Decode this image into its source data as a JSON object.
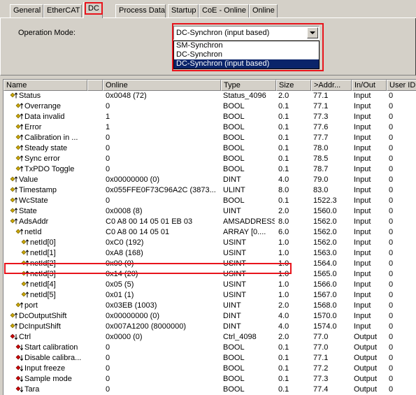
{
  "tabs": [
    {
      "label": "General"
    },
    {
      "label": "EtherCAT"
    },
    {
      "label": "DC"
    },
    {
      "label": "Process Data"
    },
    {
      "label": "Startup"
    },
    {
      "label": "CoE - Online"
    },
    {
      "label": "Online"
    }
  ],
  "dc": {
    "operation_mode_label": "Operation Mode:",
    "selected": "DC-Synchron (input based)",
    "options": [
      "SM-Synchron",
      "DC-Synchron",
      "DC-Synchron (input based)"
    ]
  },
  "columns": [
    "Name",
    "Online",
    "Type",
    "Size",
    ">Addr...",
    "In/Out",
    "User ID"
  ],
  "colors": {
    "input_icon": "#c8a400",
    "output_icon": "#cc0000",
    "highlight": "#e8141c",
    "selection": "#0a246a"
  },
  "rows": [
    {
      "name": "Status",
      "online": "0x0048 (72)",
      "type": "Status_4096",
      "size": "2.0",
      "addr": "77.1",
      "io": "Input",
      "uid": "0",
      "indent": 0,
      "dir": "in",
      "expand": "minus"
    },
    {
      "name": "Overrange",
      "online": "0",
      "type": "BOOL",
      "size": "0.1",
      "addr": "77.1",
      "io": "Input",
      "uid": "0",
      "indent": 1,
      "dir": "in"
    },
    {
      "name": "Data invalid",
      "online": "1",
      "type": "BOOL",
      "size": "0.1",
      "addr": "77.3",
      "io": "Input",
      "uid": "0",
      "indent": 1,
      "dir": "in"
    },
    {
      "name": "Error",
      "online": "1",
      "type": "BOOL",
      "size": "0.1",
      "addr": "77.6",
      "io": "Input",
      "uid": "0",
      "indent": 1,
      "dir": "in"
    },
    {
      "name": "Calibration in ...",
      "online": "0",
      "type": "BOOL",
      "size": "0.1",
      "addr": "77.7",
      "io": "Input",
      "uid": "0",
      "indent": 1,
      "dir": "in"
    },
    {
      "name": "Steady state",
      "online": "0",
      "type": "BOOL",
      "size": "0.1",
      "addr": "78.0",
      "io": "Input",
      "uid": "0",
      "indent": 1,
      "dir": "in"
    },
    {
      "name": "Sync error",
      "online": "0",
      "type": "BOOL",
      "size": "0.1",
      "addr": "78.5",
      "io": "Input",
      "uid": "0",
      "indent": 1,
      "dir": "in"
    },
    {
      "name": "TxPDO Toggle",
      "online": "0",
      "type": "BOOL",
      "size": "0.1",
      "addr": "78.7",
      "io": "Input",
      "uid": "0",
      "indent": 1,
      "dir": "in"
    },
    {
      "name": "Value",
      "online": "0x00000000 (0)",
      "type": "DINT",
      "size": "4.0",
      "addr": "79.0",
      "io": "Input",
      "uid": "0",
      "indent": 0,
      "dir": "in"
    },
    {
      "name": "Timestamp",
      "online": "0x055FFE0F73C96A2C (3873...",
      "type": "ULINT",
      "size": "8.0",
      "addr": "83.0",
      "io": "Input",
      "uid": "0",
      "indent": 0,
      "dir": "in"
    },
    {
      "name": "WcState",
      "online": "0",
      "type": "BOOL",
      "size": "0.1",
      "addr": "1522.3",
      "io": "Input",
      "uid": "0",
      "indent": 0,
      "dir": "in"
    },
    {
      "name": "State",
      "online": "0x0008 (8)",
      "type": "UINT",
      "size": "2.0",
      "addr": "1560.0",
      "io": "Input",
      "uid": "0",
      "indent": 0,
      "dir": "in"
    },
    {
      "name": "AdsAddr",
      "online": "C0 A8 00 14 05 01 EB 03",
      "type": "AMSADDRESS",
      "size": "8.0",
      "addr": "1562.0",
      "io": "Input",
      "uid": "0",
      "indent": 0,
      "dir": "in",
      "expand": "minus"
    },
    {
      "name": "netId",
      "online": "C0 A8 00 14 05 01",
      "type": "ARRAY [0....",
      "size": "6.0",
      "addr": "1562.0",
      "io": "Input",
      "uid": "0",
      "indent": 1,
      "dir": "in",
      "expand": "minus"
    },
    {
      "name": "netId[0]",
      "online": "0xC0 (192)",
      "type": "USINT",
      "size": "1.0",
      "addr": "1562.0",
      "io": "Input",
      "uid": "0",
      "indent": 2,
      "dir": "in"
    },
    {
      "name": "netId[1]",
      "online": "0xA8 (168)",
      "type": "USINT",
      "size": "1.0",
      "addr": "1563.0",
      "io": "Input",
      "uid": "0",
      "indent": 2,
      "dir": "in"
    },
    {
      "name": "netId[2]",
      "online": "0x00 (0)",
      "type": "USINT",
      "size": "1.0",
      "addr": "1564.0",
      "io": "Input",
      "uid": "0",
      "indent": 2,
      "dir": "in"
    },
    {
      "name": "netId[3]",
      "online": "0x14 (20)",
      "type": "USINT",
      "size": "1.0",
      "addr": "1565.0",
      "io": "Input",
      "uid": "0",
      "indent": 2,
      "dir": "in"
    },
    {
      "name": "netId[4]",
      "online": "0x05 (5)",
      "type": "USINT",
      "size": "1.0",
      "addr": "1566.0",
      "io": "Input",
      "uid": "0",
      "indent": 2,
      "dir": "in"
    },
    {
      "name": "netId[5]",
      "online": "0x01 (1)",
      "type": "USINT",
      "size": "1.0",
      "addr": "1567.0",
      "io": "Input",
      "uid": "0",
      "indent": 2,
      "dir": "in"
    },
    {
      "name": "port",
      "online": "0x03EB (1003)",
      "type": "UINT",
      "size": "2.0",
      "addr": "1568.0",
      "io": "Input",
      "uid": "0",
      "indent": 1,
      "dir": "in"
    },
    {
      "name": "DcOutputShift",
      "online": "0x00000000 (0)",
      "type": "DINT",
      "size": "4.0",
      "addr": "1570.0",
      "io": "Input",
      "uid": "0",
      "indent": 0,
      "dir": "in"
    },
    {
      "name": "DcInputShift",
      "online": "0x007A1200 (8000000)",
      "type": "DINT",
      "size": "4.0",
      "addr": "1574.0",
      "io": "Input",
      "uid": "0",
      "indent": 0,
      "dir": "in"
    },
    {
      "name": "Ctrl",
      "online": "0x0000 (0)",
      "type": "Ctrl_4098",
      "size": "2.0",
      "addr": "77.0",
      "io": "Output",
      "uid": "0",
      "indent": 0,
      "dir": "out",
      "expand": "minus"
    },
    {
      "name": "Start calibration",
      "online": "0",
      "type": "BOOL",
      "size": "0.1",
      "addr": "77.0",
      "io": "Output",
      "uid": "0",
      "indent": 1,
      "dir": "out"
    },
    {
      "name": "Disable calibra...",
      "online": "0",
      "type": "BOOL",
      "size": "0.1",
      "addr": "77.1",
      "io": "Output",
      "uid": "0",
      "indent": 1,
      "dir": "out"
    },
    {
      "name": "Input freeze",
      "online": "0",
      "type": "BOOL",
      "size": "0.1",
      "addr": "77.2",
      "io": "Output",
      "uid": "0",
      "indent": 1,
      "dir": "out"
    },
    {
      "name": "Sample mode",
      "online": "0",
      "type": "BOOL",
      "size": "0.1",
      "addr": "77.3",
      "io": "Output",
      "uid": "0",
      "indent": 1,
      "dir": "out"
    },
    {
      "name": "Tara",
      "online": "0",
      "type": "BOOL",
      "size": "0.1",
      "addr": "77.4",
      "io": "Output",
      "uid": "0",
      "indent": 1,
      "dir": "out"
    }
  ]
}
